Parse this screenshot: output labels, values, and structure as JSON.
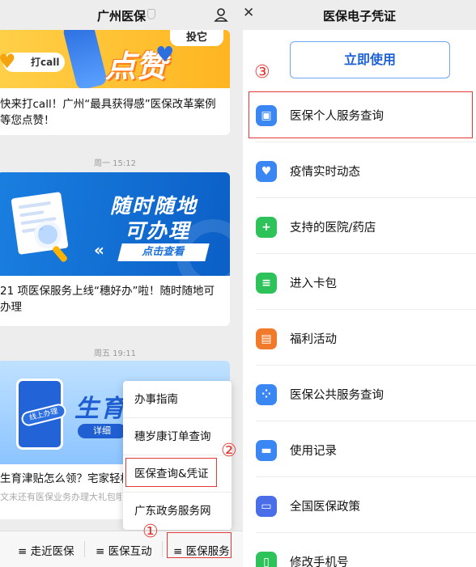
{
  "left_window": {
    "title": "广州医保",
    "posts": [
      {
        "banner_badge": "打call",
        "banner_headline": "点赞",
        "banner_tag": "投它",
        "text": "快来打call！广州“最具获得感”医保改革案例等您点赞！"
      },
      {
        "timestamp": "周一 15:12",
        "banner_line1": "随时随地",
        "banner_line2": "可办理",
        "banner_button": "点击查看",
        "text": "21 项医保服务上线“穗好办”啦！随时随地可办理"
      },
      {
        "timestamp": "周五 19:11",
        "banner_headline": "生育",
        "banner_tag": "线上办理",
        "banner_button": "详细",
        "text": "生育津贴怎么领？宅家轻松",
        "subtext": "文末还有医保业务办理大礼包哦"
      }
    ],
    "popup_menu": [
      "办事指南",
      "穗岁康订单查询",
      "医保查询&凭证",
      "广东政务服务网"
    ],
    "bottom_menu": [
      "≡ 走近医保",
      "≡ 医保互动",
      "≡ 医保服务"
    ]
  },
  "right_window": {
    "title": "医保电子凭证",
    "use_button": "立即使用",
    "menu_items": [
      {
        "label": "医保个人服务查询",
        "icon": "id-card-search-icon",
        "color": "#3a86f2"
      },
      {
        "label": "疫情实时动态",
        "icon": "heart-shield-icon",
        "color": "#3a86f2"
      },
      {
        "label": "支持的医院/药店",
        "icon": "medical-cross-icon",
        "color": "#2ec25a"
      },
      {
        "label": "进入卡包",
        "icon": "card-wallet-icon",
        "color": "#2ec25a"
      },
      {
        "label": "福利活动",
        "icon": "gift-icon",
        "color": "#f07a2a"
      },
      {
        "label": "医保公共服务查询",
        "icon": "grid-apps-icon",
        "color": "#3a86f2"
      },
      {
        "label": "使用记录",
        "icon": "record-card-icon",
        "color": "#3a86f2"
      },
      {
        "label": "全国医保政策",
        "icon": "policy-screen-icon",
        "color": "#4a6ee8"
      },
      {
        "label": "修改手机号",
        "icon": "phone-icon",
        "color": "#2ec25a"
      }
    ]
  },
  "annotations": {
    "step1": "①",
    "step2": "②",
    "step3": "③",
    "highlight_color": "#e53935"
  }
}
